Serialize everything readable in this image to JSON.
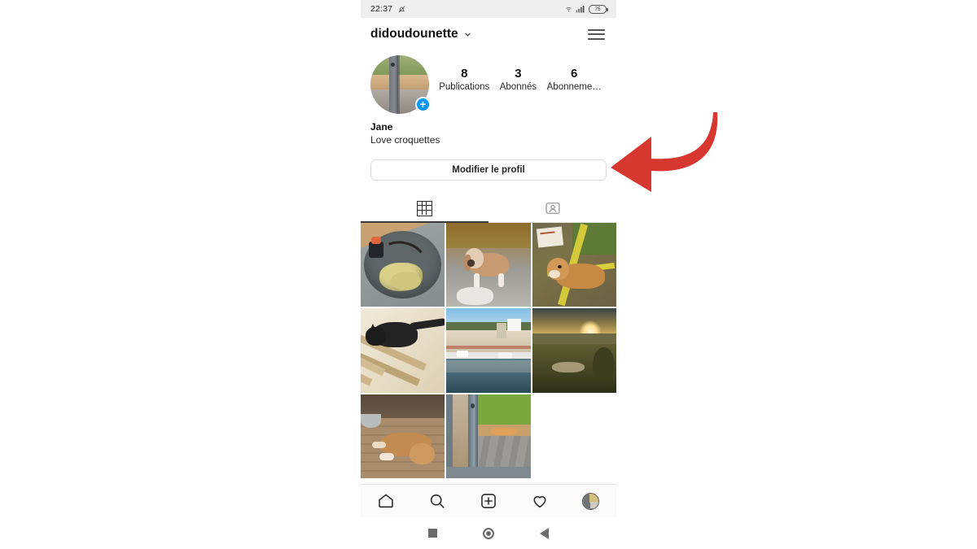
{
  "status_bar": {
    "time": "22:37",
    "icons": [
      "bell-muted-icon",
      "wifi-icon",
      "signal-icon"
    ],
    "battery_level": "75"
  },
  "header": {
    "username": "didoudounette",
    "chevron": "chevron-down-icon",
    "menu": "hamburger-menu-icon"
  },
  "profile": {
    "avatar_badge": "+",
    "name": "Jane",
    "bio": "Love croquettes",
    "stats": [
      {
        "value": "8",
        "label": "Publications"
      },
      {
        "value": "3",
        "label": "Abonnés"
      },
      {
        "value": "6",
        "label": "Abonneme…"
      }
    ],
    "edit_button": "Modifier le profil"
  },
  "tabs": [
    {
      "name": "grid-tab",
      "icon": "grid-icon",
      "active": true
    },
    {
      "name": "tagged-tab",
      "icon": "tagged-person-icon",
      "active": false
    }
  ],
  "photo_grid": {
    "count": 8,
    "items": [
      {
        "id": "post-1",
        "alt": "food-plate",
        "art": "a-food"
      },
      {
        "id": "post-2",
        "alt": "beagle-on-rocks",
        "art": "a-beagle"
      },
      {
        "id": "post-3",
        "alt": "golden-dog-lying",
        "art": "a-golden"
      },
      {
        "id": "post-4",
        "alt": "black-cat-on-ladder",
        "art": "a-cat"
      },
      {
        "id": "post-5",
        "alt": "harbor-town",
        "art": "a-harbor"
      },
      {
        "id": "post-6",
        "alt": "sunset-landscape",
        "art": "a-sunset"
      },
      {
        "id": "post-7",
        "alt": "sleeping-dog-deck",
        "art": "a-sleep"
      },
      {
        "id": "post-8",
        "alt": "door-view-cat",
        "art": "a-door"
      }
    ]
  },
  "bottom_nav": [
    {
      "name": "home-icon",
      "label": "Home"
    },
    {
      "name": "search-icon",
      "label": "Search"
    },
    {
      "name": "add-post-icon",
      "label": "Add"
    },
    {
      "name": "heart-icon",
      "label": "Activity"
    },
    {
      "name": "profile-avatar-icon",
      "label": "Profile"
    }
  ],
  "android_nav": [
    {
      "name": "recents-button"
    },
    {
      "name": "home-button"
    },
    {
      "name": "back-button"
    }
  ],
  "annotation": {
    "type": "red-curved-arrow",
    "color": "#d6382f",
    "points_to": "Modifier le profil"
  },
  "colors": {
    "accent_blue": "#0095f6",
    "annotation_red": "#d6382f",
    "page_background": "#ffffff",
    "statusbar_background": "#eeeeee"
  }
}
